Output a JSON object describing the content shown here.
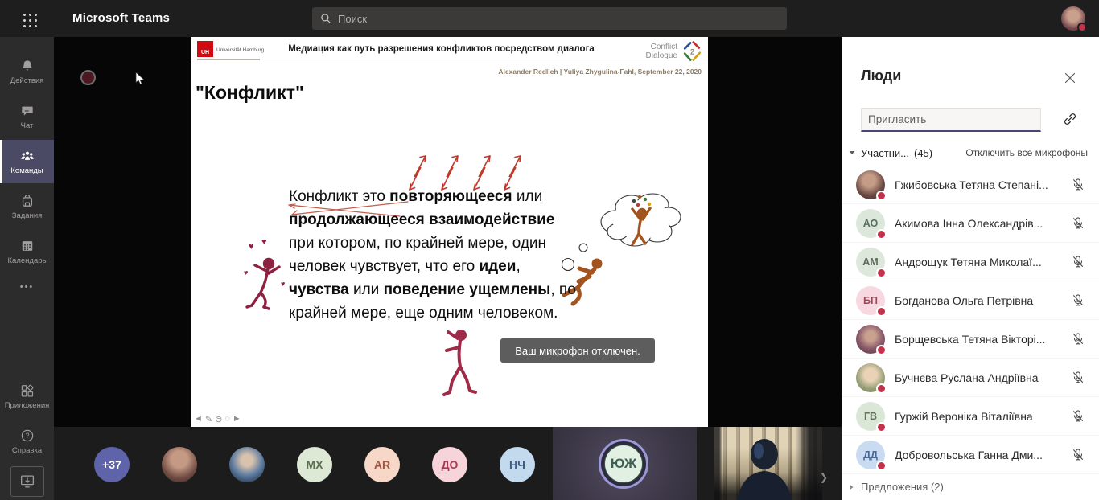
{
  "topbar": {
    "app_title": "Microsoft Teams",
    "search_placeholder": "Поиск"
  },
  "icons": {
    "more": "•••",
    "help_glyph": "?"
  },
  "sidebar": {
    "items": [
      {
        "label": "Действия"
      },
      {
        "label": "Чат"
      },
      {
        "label": "Команды"
      },
      {
        "label": "Задания"
      },
      {
        "label": "Календарь"
      }
    ],
    "bottom_items": [
      {
        "label": "Приложения"
      },
      {
        "label": "Справка"
      }
    ]
  },
  "slide": {
    "uni_logo_sq": "UH",
    "uni_logo_text": "Universität Hamburg",
    "header_title": "Медиация как путь разрешения конфликтов посредством диалога",
    "logo_right_line1": "Conflict",
    "logo_right_line2": "Dialogue",
    "logo_badge": "2",
    "authors": "Alexander Redlich | Yuliya Zhygulina-Fahl, September 22, 2020",
    "title": "\"Конфликт\"",
    "body_segments": [
      {
        "text": "Конфликт это ",
        "bold": false
      },
      {
        "text": "повторяющееся",
        "bold": true
      },
      {
        "text": " или ",
        "bold": false
      },
      {
        "text": "продолжающееся взаимодействие",
        "bold": true
      },
      {
        "text": " при котором, по крайней мере, один человек чувствует, что его ",
        "bold": false
      },
      {
        "text": "идеи",
        "bold": true
      },
      {
        "text": ", ",
        "bold": false
      },
      {
        "text": "чувства",
        "bold": true
      },
      {
        "text": " или ",
        "bold": false
      },
      {
        "text": "поведение ущемлены",
        "bold": true
      },
      {
        "text": ", по крайней мере, еще одним человеком.",
        "bold": false
      }
    ],
    "mic_toast": "Ваш микрофон отключен.",
    "toolbar_icons": [
      "◄",
      "✎",
      "⊜",
      "◌",
      "►"
    ]
  },
  "people_panel": {
    "title": "Люди",
    "invite_placeholder": "Пригласить",
    "participants_label": "Участни...",
    "participants_count": "(45)",
    "mute_all_label": "Отключить все микрофоны",
    "presence_busy_color": "#c4314b",
    "participants": [
      {
        "name": "Гжибовська Тетяна Степані...",
        "photo": "radial-gradient(circle at 45% 35%, #c59d87 25%, #6b4a44 60%, #3a2a2e 100%)"
      },
      {
        "name": "Акимова Інна Олександрів...",
        "initials": "АО",
        "bg": "#dbe7db",
        "fg": "#57705c"
      },
      {
        "name": "Андрощук Тетяна Миколаї...",
        "initials": "АМ",
        "bg": "#dde7dc",
        "fg": "#5a6b58"
      },
      {
        "name": "Богданова Ольга Петрівна",
        "initials": "БП",
        "bg": "#f7d8e0",
        "fg": "#a04458"
      },
      {
        "name": "Борщевська Тетяна Вікторі...",
        "photo": "radial-gradient(circle at 50% 40%, #c9a18f 22%, #8a5a6a 55%, #4e3347 100%)"
      },
      {
        "name": "Бучнєва Руслана Андріївна",
        "photo": "radial-gradient(circle at 50% 40%, #e9d2b6 28%, #9aa27a 60%, #66754e 100%)"
      },
      {
        "name": "Гуржій Вероніка Віталіївна",
        "initials": "ГВ",
        "bg": "#dbe7d6",
        "fg": "#5f7355"
      },
      {
        "name": "Добровольська Ганна Дми...",
        "initials": "ДД",
        "bg": "#c9dbf0",
        "fg": "#44679c"
      }
    ],
    "suggestions_label": "Предложения (2)"
  },
  "bottom_strip": {
    "avatars": [
      {
        "label": "+37",
        "bg": "#5f63a9",
        "fg": "#ffffff"
      },
      {
        "photo": "radial-gradient(circle at 50% 35%, #c59a85 28%, #6e4a42 65%, #3a2926 100%)"
      },
      {
        "photo": "radial-gradient(circle at 50% 38%, #d8c2ae 20%, #5a7aa0 55%, #161c28 100%)"
      },
      {
        "label": "MX",
        "bg": "#dde8d5",
        "fg": "#5a6e50"
      },
      {
        "label": "AR",
        "bg": "#f6d7c8",
        "fg": "#a05540"
      },
      {
        "label": "ДО",
        "bg": "#f6d4da",
        "fg": "#a53a50"
      },
      {
        "label": "НЧ",
        "bg": "#c3d9ee",
        "fg": "#3f5d85"
      }
    ],
    "active_speaker": {
      "initials": "ЮЖ",
      "bg": "#e2f0e4",
      "fg": "#3f5f52",
      "ring": "#9a99d6"
    }
  },
  "accent_color": "#6264a7"
}
